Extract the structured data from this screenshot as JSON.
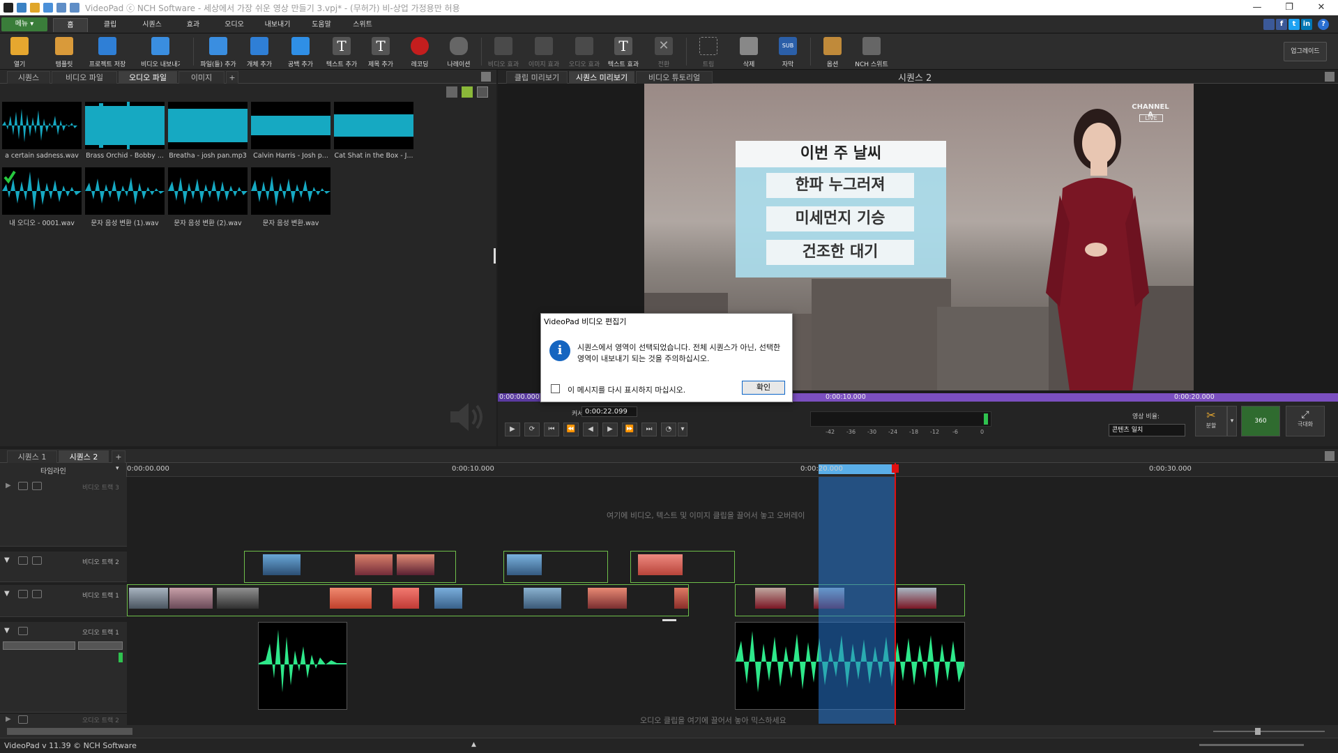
{
  "window": {
    "title": "VideoPad ⓒ NCH Software - 세상에서 가장 쉬운 영상 만들기 3.vpj* - (무허가) 비-상업 가정용만 허용",
    "minimize": "—",
    "maximize": "❐",
    "close": "✕"
  },
  "menu": {
    "main_button": "메뉴 ▾",
    "tabs": [
      "홈",
      "클립",
      "시퀀스",
      "효과",
      "오디오",
      "내보내기",
      "도움말",
      "스위트"
    ],
    "social": [
      "f",
      "t",
      "in",
      "?"
    ]
  },
  "toolbar": {
    "buttons": [
      "열기",
      "템플릿",
      "프로젝트 저장",
      "비디오 내보내기",
      "파일(들) 추가",
      "개체 추가",
      "공백 추가",
      "텍스트 추가",
      "제목 추가",
      "레코딩",
      "나레이션",
      "비디오 효과",
      "이미지 효과",
      "오디오 효과",
      "텍스트 효과",
      "전환",
      "트림",
      "삭제",
      "자막",
      "옵션",
      "NCH 스위트"
    ],
    "upgrade": "업그레이드"
  },
  "bin": {
    "tabs": [
      "시퀀스",
      "비디오 파일",
      "오디오 파일",
      "이미지",
      "+"
    ],
    "clips": [
      "a certain sadness.wav",
      "Brass Orchid - Bobby ...",
      "Breatha - josh pan.mp3",
      "Calvin Harris - Josh p...",
      "Cat Shat in the Box - J...",
      "내 오디오 - 0001.wav",
      "문자 음성 변환 (1).wav",
      "문자 음성 변환 (2).wav",
      "문자 음성 변환.wav"
    ]
  },
  "preview": {
    "tabs": [
      "클립 미리보기",
      "시퀀스 미리보기",
      "비디오 튜토리얼"
    ],
    "sequence_label": "시퀀스 2",
    "weather_title": "이번 주 날씨",
    "weather_items": [
      "한파 누그러져",
      "미세먼지 기승",
      "건조한 대기"
    ],
    "channel_logo": "CHANNEL A",
    "channel_live": "LIVE",
    "scrub_times": [
      "0:00:00.000",
      "0:00:10.000",
      "0:00:20.000"
    ],
    "cursor_label": "커서:",
    "cursor_time": "0:00:22.099",
    "meter_ticks": [
      "-42",
      "-36",
      "-30",
      "-24",
      "-18",
      "-12",
      "-6",
      "0"
    ],
    "aspect_label": "영상 비율:",
    "aspect_value": "콘텐츠 일치",
    "split_label": "분할",
    "vr_label": "360",
    "fullscreen_label": "극대화"
  },
  "dialog": {
    "title": "VideoPad 비디오 편집기",
    "message": "시퀀스에서 영역이 선택되었습니다. 전체 시퀀스가 아닌, 선택한 영역이 내보내기 되는 것을 주의하십시오.",
    "checkbox_label": "이 메시지를 다시 표시하지 마십시오.",
    "ok": "확인"
  },
  "timeline": {
    "seq_tabs": [
      "시퀀스 1",
      "시퀀스 2",
      "+"
    ],
    "mode": "타임라인",
    "ruler": [
      "0:00:00.000",
      "0:00:10.000",
      "0:00:20.000",
      "0:00:30.000"
    ],
    "tracks": [
      "비디오 트랙 3",
      "비디오 트랙 2",
      "비디오 트랙 1",
      "오디오 트랙 1",
      "오디오 트랙 2"
    ],
    "video_hint": "여기에 비디오, 텍스트 및 이미지 클립을 끌어서 놓고 오버레이",
    "audio_hint": "오디오 클립을 여기에 끌어서 놓아 믹스하세요"
  },
  "status": {
    "version": "VideoPad v 11.39 © NCH Software"
  },
  "colors": {
    "accent_green": "#3a7d3a",
    "waveform_cyan": "#16a9c2",
    "waveform_green": "#2ee88a",
    "selection_blue": "#2878d2",
    "playhead_red": "#e01010",
    "scrub_purple": "#7b4fc0"
  }
}
